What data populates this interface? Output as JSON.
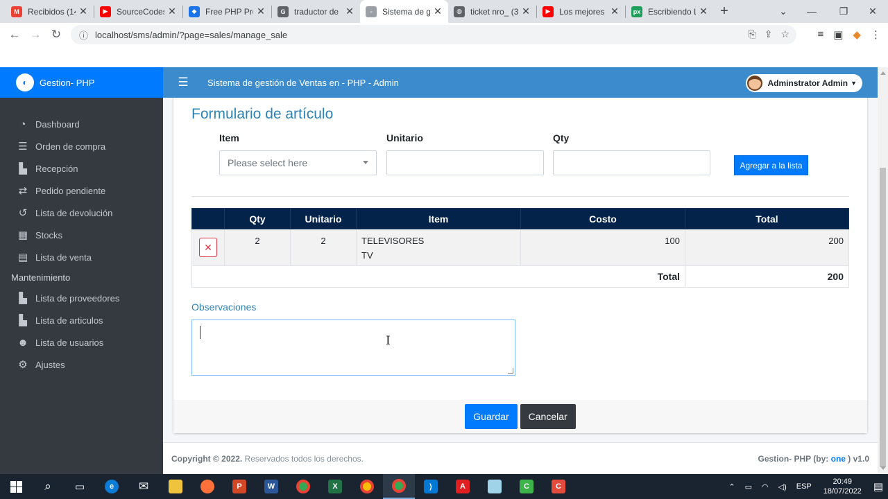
{
  "browser": {
    "tabs": [
      {
        "title": "Recibidos (14",
        "icon": "gmail-icon",
        "color": "#ea4335",
        "glyph": "M"
      },
      {
        "title": "SourceCodes",
        "icon": "youtube-icon",
        "color": "#ff0000",
        "glyph": "▶"
      },
      {
        "title": "Free PHP Pro",
        "icon": "drop-icon",
        "color": "#1a73e8",
        "glyph": "◆"
      },
      {
        "title": "traductor de",
        "icon": "google-icon",
        "color": "#5f6368",
        "glyph": "G"
      },
      {
        "title": "Sistema de g",
        "icon": "page-icon",
        "color": "#9aa0a6",
        "glyph": "▫",
        "active": true
      },
      {
        "title": "ticket nro_ (3",
        "icon": "globe-icon",
        "color": "#5f6368",
        "glyph": "◍"
      },
      {
        "title": "Los mejores",
        "icon": "youtube-icon",
        "color": "#ff0000",
        "glyph": "▶"
      },
      {
        "title": "Escribiendo L",
        "icon": "px-icon",
        "color": "#1f9e5c",
        "glyph": "px"
      }
    ],
    "url": "localhost/sms/admin/?page=sales/manage_sale"
  },
  "app": {
    "brand": "Gestion- PHP",
    "title": "Sistema de gestión de Ventas en - PHP - Admin",
    "user": "Adminstrator Admin"
  },
  "sidebar": {
    "items": [
      {
        "label": "Dashboard",
        "icon": "dashboard-icon",
        "glyph": "◔"
      },
      {
        "label": "Orden de compra",
        "icon": "table-icon",
        "glyph": "☰"
      },
      {
        "label": "Recepción",
        "icon": "boxes-icon",
        "glyph": "▙"
      },
      {
        "label": "Pedido pendiente",
        "icon": "exchange-icon",
        "glyph": "⇄"
      },
      {
        "label": "Lista de devolución",
        "icon": "undo-icon",
        "glyph": "↺"
      },
      {
        "label": "Stocks",
        "icon": "table-icon",
        "glyph": "▦"
      }
    ],
    "items2": [
      {
        "label": "Lista de venta",
        "icon": "file-invoice-icon",
        "glyph": "▤"
      }
    ],
    "section": "Mantenimiento",
    "maint": [
      {
        "label": "Lista de proveedores",
        "icon": "truck-icon",
        "glyph": "▙"
      },
      {
        "label": "Lista de articulos",
        "icon": "boxes-icon",
        "glyph": "▙"
      },
      {
        "label": "Lista de usuarios",
        "icon": "users-icon",
        "glyph": "☻"
      },
      {
        "label": "Ajustes",
        "icon": "cogs-icon",
        "glyph": "⚙"
      }
    ]
  },
  "form": {
    "title": "Formulario de artículo",
    "item_label": "Item",
    "unit_label": "Unitario",
    "qty_label": "Qty",
    "item_placeholder": "Please select here",
    "add_button": "Agregar a la lista"
  },
  "table": {
    "headers": [
      "",
      "Qty",
      "Unitario",
      "Item",
      "Costo",
      "Total"
    ],
    "rows": [
      {
        "qty": "2",
        "unit": "2",
        "item_name": "TELEVISORES",
        "item_desc": "TV",
        "cost": "100",
        "total": "200"
      }
    ],
    "total_label": "Total",
    "grand_total": "200"
  },
  "observations": {
    "label": "Observaciones",
    "value": ""
  },
  "actions": {
    "save": "Guardar",
    "cancel": "Cancelar"
  },
  "footer": {
    "copyright": "Copyright © 2022.",
    "rights": " Reservados todos los derechos.",
    "credit_prefix": "Gestion- PHP (by: ",
    "credit_link": "one",
    "credit_suffix": " ) v1.0"
  },
  "taskbar": {
    "time": "20:49",
    "date": "18/07/2022",
    "lang": "ESP"
  }
}
